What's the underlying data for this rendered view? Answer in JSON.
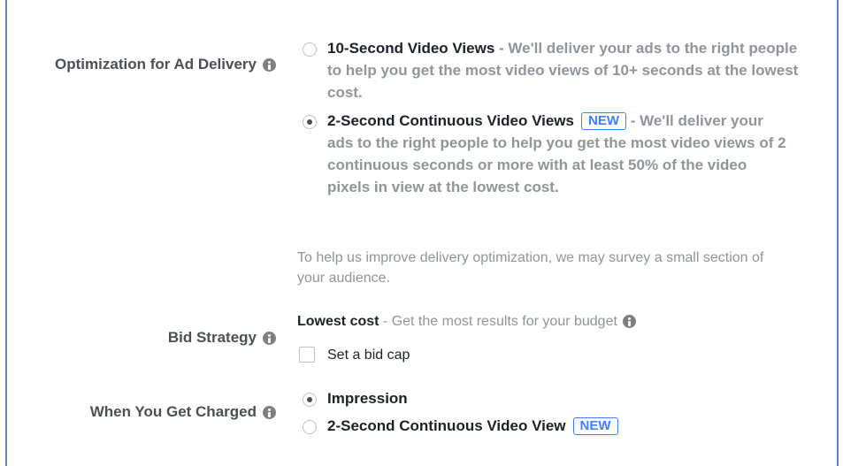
{
  "optimization": {
    "label": "Optimization for Ad Delivery",
    "options": [
      {
        "title": "10-Second Video Views",
        "description": " - We'll deliver your ads to the right people to help you get the most video views of 10+ seconds at the lowest cost.",
        "selected": false
      },
      {
        "title": "2-Second Continuous Video Views",
        "badge": "NEW",
        "description": " - We'll deliver your ads to the right people to help you get the most video views of 2 continuous seconds or more with at least 50% of the video pixels in view at the lowest cost.",
        "selected": true
      }
    ],
    "survey_note": "To help us improve delivery optimization, we may survey a small section of your audience."
  },
  "bid_strategy": {
    "label": "Bid Strategy",
    "value": "Lowest cost",
    "description": " - Get the most results for your budget",
    "bid_cap_label": "Set a bid cap",
    "bid_cap_checked": false
  },
  "charged": {
    "label": "When You Get Charged",
    "options": [
      {
        "title": "Impression",
        "selected": true
      },
      {
        "title": "2-Second Continuous Video View",
        "badge": "NEW",
        "selected": false
      }
    ]
  },
  "colors": {
    "frame_border": "#5b87c6",
    "badge_blue": "#4080ff",
    "muted_text": "#90949c"
  },
  "icons": [
    "info-icon"
  ]
}
